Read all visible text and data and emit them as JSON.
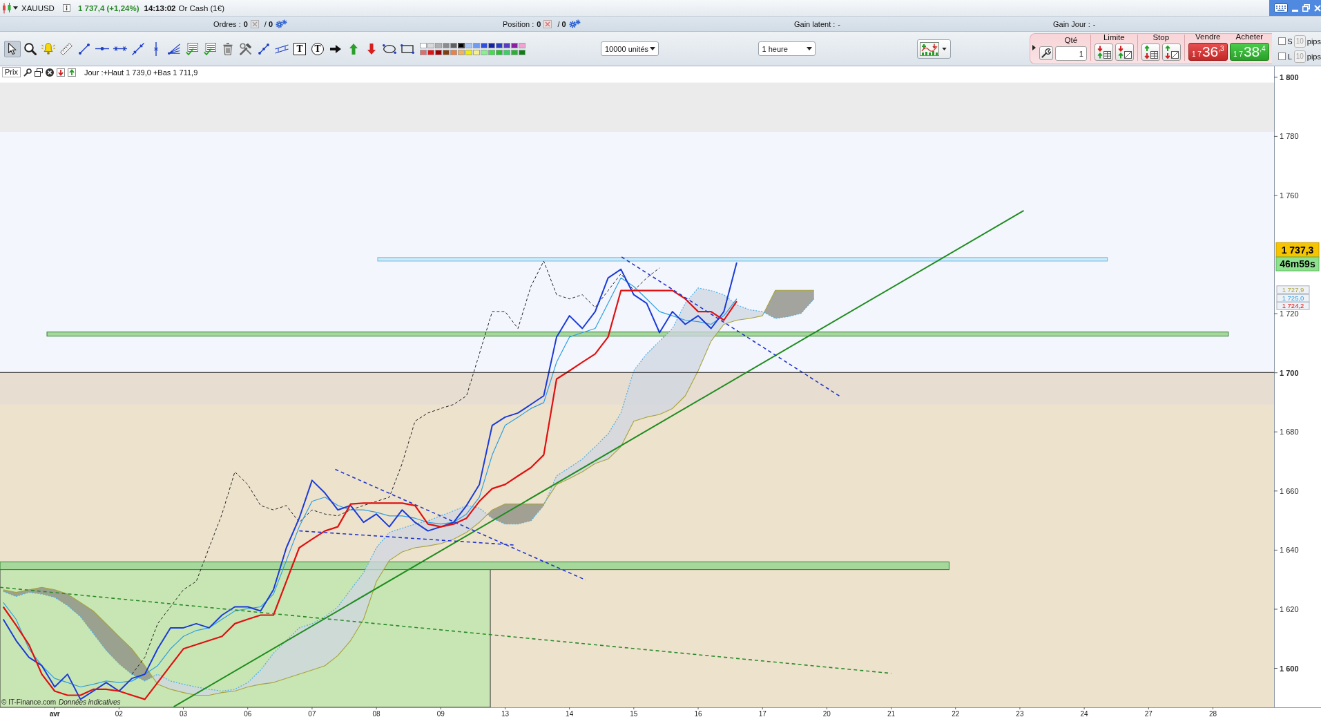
{
  "window": {
    "symbol": "XAUUSD",
    "quote": "1 737,4 (+1,24%)",
    "time": "14:13:02",
    "instrument": "Or Cash (1€)"
  },
  "account_bar": {
    "orders": {
      "label": "Ordres :",
      "count": "0",
      "pending": "/ **0**"
    },
    "position": {
      "label": "Position :",
      "count": "0",
      "pending": "/ **0**"
    },
    "unrealized_gain": {
      "label": "Gain latent :",
      "value": "-"
    },
    "daily_gain": {
      "label": "Gain Jour :",
      "value": "-"
    }
  },
  "toolbar": {
    "tools": [
      {
        "kind": "pointer",
        "selected": true
      },
      {
        "kind": "zoom",
        "selected": false
      },
      {
        "kind": "alert",
        "selected": false
      },
      {
        "kind": "ruler",
        "selected": false
      },
      {
        "kind": "segment",
        "selected": false
      },
      {
        "kind": "horizontal",
        "selected": false
      },
      {
        "kind": "hsegment",
        "selected": false
      },
      {
        "kind": "ray",
        "selected": false
      },
      {
        "kind": "vertical",
        "selected": false
      },
      {
        "kind": "fan",
        "selected": false
      },
      {
        "kind": "fibonacci",
        "selected": false
      },
      {
        "kind": "fibozone",
        "selected": false
      },
      {
        "kind": "delete",
        "selected": false
      },
      {
        "kind": "tools",
        "selected": false
      },
      {
        "kind": "cross",
        "selected": false
      },
      {
        "kind": "channel",
        "selected": false
      },
      {
        "kind": "text",
        "glyph": "T",
        "selected": false
      },
      {
        "kind": "bubble",
        "glyph": "T",
        "selected": false
      },
      {
        "kind": "arrowright",
        "selected": false
      },
      {
        "kind": "arrowup",
        "selected": false
      },
      {
        "kind": "arrowdown",
        "selected": false
      },
      {
        "kind": "ellipse",
        "selected": false
      },
      {
        "kind": "rectangle",
        "selected": false
      }
    ],
    "palette": [
      {
        "color": "#ffffff",
        "selected": false
      },
      {
        "color": "#d9d9d9",
        "selected": false
      },
      {
        "color": "#b0b0b0",
        "selected": false
      },
      {
        "color": "#8c8c8c",
        "selected": false
      },
      {
        "color": "#606060",
        "selected": false
      },
      {
        "color": "#000000",
        "selected": true
      },
      {
        "color": "#a9c6f5",
        "selected": false
      },
      {
        "color": "#6f9cf0",
        "selected": false
      },
      {
        "color": "#2f4fe0",
        "selected": false
      },
      {
        "color": "#14239e",
        "selected": false
      },
      {
        "color": "#2a3fc4",
        "selected": false
      },
      {
        "color": "#5a3cc0",
        "selected": false
      },
      {
        "color": "#8a1fa4",
        "selected": false
      },
      {
        "color": "#f2a3d2",
        "selected": false
      },
      {
        "color": "#e26c6c",
        "selected": false
      },
      {
        "color": "#e21212",
        "selected": false
      },
      {
        "color": "#a00000",
        "selected": false
      },
      {
        "color": "#7f3f10",
        "selected": false
      },
      {
        "color": "#f08040",
        "selected": false
      },
      {
        "color": "#f4b25c",
        "selected": false
      },
      {
        "color": "#f2ee00",
        "selected": false
      },
      {
        "color": "#f4f08a",
        "selected": false
      },
      {
        "color": "#88f08c",
        "selected": false
      },
      {
        "color": "#40e048",
        "selected": false
      },
      {
        "color": "#22c428",
        "selected": false
      },
      {
        "color": "#3dcf64",
        "selected": false
      },
      {
        "color": "#2fae34",
        "selected": false
      },
      {
        "color": "#127d14",
        "selected": false
      }
    ],
    "quantity_select": {
      "value": "10000 unités"
    },
    "period_select": {
      "value": "1 heure"
    }
  },
  "order_panel": {
    "quantity": {
      "label": "Qté",
      "value": "1"
    },
    "limit": {
      "label": "Limite"
    },
    "stop": {
      "label": "Stop"
    },
    "sell": {
      "label": "Vendre",
      "prefix": "1 7",
      "main": "36",
      "suffix": ",3"
    },
    "buy": {
      "label": "Acheter",
      "prefix": "1 7",
      "main": "38",
      "suffix": ",4"
    },
    "stops": [
      {
        "label": "S",
        "checked": false,
        "pips": "10",
        "disabled": true,
        "unit": "pips"
      },
      {
        "label": "L",
        "checked": false,
        "pips": "10",
        "disabled": true,
        "unit": "pips"
      }
    ]
  },
  "chart": {
    "header": {
      "label": "Prix",
      "info": "Jour :+Haut 1 739,0 +Bas 1 711,9"
    },
    "attribution": "© IT-Finance.com",
    "disclaimer": "Données indicatives",
    "chart_data": {
      "type": "line",
      "categories": [
        null,
        null,
        null,
        null,
        "avr",
        null,
        null,
        null,
        null,
        "02",
        null,
        null,
        null,
        null,
        "03",
        null,
        null,
        null,
        null,
        "06",
        null,
        null,
        null,
        null,
        "07",
        null,
        null,
        null,
        null,
        "08",
        null,
        null,
        null,
        null,
        "09",
        null,
        null,
        null,
        null,
        "13",
        null,
        null,
        null,
        null,
        "14",
        null,
        null,
        null,
        null,
        "15",
        null,
        null,
        null,
        null,
        "16",
        null,
        null,
        null,
        null,
        "17",
        null,
        null,
        null,
        null,
        "20",
        null,
        null,
        null,
        null,
        "21",
        null,
        null,
        null,
        null,
        "22",
        null,
        null,
        null,
        null,
        "23",
        null,
        null,
        null,
        null,
        "24",
        null,
        null,
        null,
        null,
        "27",
        null,
        null,
        null,
        null,
        "28",
        null,
        null,
        null,
        null
      ],
      "ylim": [
        1586.8,
        1803.7
      ],
      "yticks": [
        {
          "value": 1800,
          "label": "1 800"
        },
        {
          "value": 1780,
          "label": "1 780"
        },
        {
          "value": 1760,
          "label": "1 760"
        },
        {
          "value": 1720,
          "label": "1 720"
        },
        {
          "value": 1700,
          "label": "1 700"
        },
        {
          "value": 1680,
          "label": "1 680"
        },
        {
          "value": 1660,
          "label": "1 660"
        },
        {
          "value": 1640,
          "label": "1 640"
        },
        {
          "value": 1620,
          "label": "1 620"
        },
        {
          "value": 1600,
          "label": "1 600"
        }
      ],
      "series": [
        {
          "color": "#a7a33a",
          "line_style": "solid",
          "values": [
            1626.6,
            1625.7,
            1626.6,
            1627.4,
            1626.6,
            1625.1,
            1622.3,
            1619.4,
            1615.1,
            1610.8,
            1606.6,
            1600.9,
            1594.6,
            1592.9,
            1591.8,
            1590.9,
            1590.9,
            1591.8,
            1592.3,
            1593.7,
            1594.6,
            1595.2,
            1596.6,
            1598.0,
            1599.4,
            1600.9,
            1604.3,
            1609.4,
            1616.6,
            1629.4,
            1636.5,
            1639.4,
            1640.8,
            1641.4,
            1642.2,
            1643.7,
            1646.0,
            1649.4,
            1653.6,
            1655.6,
            1655.6,
            1655.6,
            1655.6,
            1662.2,
            1664.2,
            1666.5,
            1669.3,
            1670.8,
            1675.0,
            1683.6,
            1685.0,
            1685.9,
            1687.9,
            1692.2,
            1700.7,
            1710.7,
            1716.4,
            1717.8,
            1718.4,
            1719.3,
            1727.9,
            1727.9,
            1727.9,
            1727.9,
            null,
            null,
            null,
            null,
            null,
            null,
            null,
            null,
            null,
            null,
            null,
            null,
            null,
            null,
            null,
            null,
            null,
            null,
            null,
            null,
            null,
            null,
            null,
            null,
            null,
            null,
            null,
            null,
            null,
            null,
            null,
            null,
            null,
            null,
            null
          ]
        },
        {
          "color": "#4fb0e8",
          "line_style": "dotted",
          "values": [
            1626.0,
            1624.3,
            1625.7,
            1625.1,
            1624.0,
            1621.2,
            1617.5,
            1611.8,
            1606.1,
            1601.5,
            1598.0,
            1595.7,
            1598.0,
            1595.7,
            1594.6,
            1593.7,
            1592.9,
            1592.3,
            1592.9,
            1595.2,
            1599.4,
            1605.1,
            1609.4,
            1613.7,
            1615.1,
            1617.5,
            1620.8,
            1626.6,
            1632.3,
            1640.8,
            1646.0,
            1647.4,
            1648.8,
            1649.9,
            1651.6,
            1653.3,
            1655.1,
            1654.2,
            1650.8,
            1648.8,
            1648.8,
            1649.9,
            1655.1,
            1665.1,
            1667.9,
            1670.8,
            1675.0,
            1679.3,
            1686.4,
            1700.7,
            1706.4,
            1710.7,
            1715.0,
            1723.5,
            1728.7,
            1727.8,
            1726.4,
            1723.0,
            1721.3,
            1720.7,
            1718.4,
            1719.0,
            1720.1,
            1725.0,
            null,
            null,
            null,
            null,
            null,
            null,
            null,
            null,
            null,
            null,
            null,
            null,
            null,
            null,
            null,
            null,
            null,
            null,
            null,
            null,
            null,
            null,
            null,
            null,
            null,
            null,
            null,
            null,
            null,
            null,
            null,
            null,
            null,
            null,
            null
          ]
        },
        {
          "color": "#222222",
          "line_style": "dashed",
          "values": [
            null,
            null,
            null,
            null,
            null,
            null,
            null,
            null,
            null,
            null,
            1598.0,
            1603.7,
            1615.1,
            1620.8,
            1626.6,
            1629.4,
            1640.8,
            1652.2,
            1666.5,
            1662.2,
            1655.1,
            1653.6,
            1655.1,
            1649.4,
            1653.6,
            1652.2,
            1651.6,
            1653.6,
            1655.1,
            1656.5,
            1657.9,
            1669.3,
            1683.6,
            1686.4,
            1687.9,
            1689.3,
            1692.2,
            1706.4,
            1720.7,
            1720.7,
            1715.0,
            1729.2,
            1737.8,
            1726.4,
            1725.0,
            1726.4,
            1722.1,
            1727.8,
            1733.5,
            1727.8,
            1732.1,
            1735.5,
            null,
            null,
            null,
            null,
            null,
            null,
            null,
            null,
            null,
            null,
            null,
            null,
            null,
            null,
            null,
            null,
            null,
            null,
            null,
            null,
            null,
            null,
            null,
            null,
            null,
            null,
            null,
            null,
            null,
            null,
            null,
            null,
            null,
            null,
            null,
            null,
            null,
            null,
            null,
            null,
            null,
            null,
            null,
            null,
            null,
            null,
            null
          ]
        },
        {
          "color": "#2e9fe0",
          "line_style": "solid",
          "values": [
            1622.3,
            1616.6,
            1606.6,
            1600.9,
            1596.6,
            1595.2,
            1593.7,
            1594.6,
            1595.7,
            1595.2,
            1595.7,
            1598.0,
            1600.9,
            1606.6,
            1610.8,
            1612.8,
            1613.7,
            1616.6,
            1619.4,
            1620.2,
            1620.8,
            1625.1,
            1636.5,
            1647.9,
            1656.5,
            1657.9,
            1655.1,
            1653.6,
            1653.6,
            1652.8,
            1651.6,
            1651.6,
            1650.8,
            1649.4,
            1648.8,
            1649.4,
            1652.2,
            1657.9,
            1672.2,
            1682.2,
            1685.0,
            1687.9,
            1689.9,
            1703.6,
            1712.1,
            1713.6,
            1715.0,
            1723.5,
            1732.1,
            1729.2,
            1725.0,
            1720.7,
            1719.3,
            1717.8,
            1717.3,
            1716.4,
            1719.3,
            1725.0,
            null,
            null,
            null,
            null,
            null,
            null,
            null,
            null,
            null,
            null,
            null,
            null,
            null,
            null,
            null,
            null,
            null,
            null,
            null,
            null,
            null,
            null,
            null,
            null,
            null,
            null,
            null,
            null,
            null,
            null,
            null,
            null,
            null,
            null,
            null,
            null,
            null,
            null,
            null,
            null,
            null
          ]
        },
        {
          "color": "#1a3ad8",
          "line_style": "solid",
          "values": [
            1616.6,
            1609.4,
            1603.7,
            1600.9,
            1593.7,
            1598.0,
            1589.5,
            1592.3,
            1595.2,
            1592.3,
            1596.6,
            1598.0,
            1606.6,
            1613.7,
            1613.7,
            1615.1,
            1613.7,
            1618.0,
            1620.8,
            1620.8,
            1619.4,
            1626.6,
            1640.8,
            1650.8,
            1663.6,
            1659.3,
            1653.6,
            1655.1,
            1649.4,
            1652.2,
            1647.9,
            1653.6,
            1649.4,
            1646.5,
            1647.9,
            1649.4,
            1655.1,
            1662.2,
            1682.2,
            1685.0,
            1686.4,
            1689.3,
            1692.2,
            1712.1,
            1719.3,
            1715.0,
            1720.7,
            1732.1,
            1735.0,
            1726.4,
            1723.5,
            1713.6,
            1720.7,
            1716.4,
            1719.3,
            1715.0,
            1720.7,
            1737.3,
            null,
            null,
            null,
            null,
            null,
            null,
            null,
            null,
            null,
            null,
            null,
            null,
            null,
            null,
            null,
            null,
            null,
            null,
            null,
            null,
            null,
            null,
            null,
            null,
            null,
            null,
            null,
            null,
            null,
            null,
            null,
            null,
            null,
            null,
            null,
            null,
            null,
            null,
            null,
            null,
            null
          ]
        },
        {
          "color": "#e01010",
          "line_style": "solid",
          "values": [
            1620.8,
            1614.6,
            1608.0,
            1598.0,
            1592.3,
            1590.9,
            1590.9,
            1592.9,
            1592.9,
            1592.3,
            1590.9,
            1589.5,
            1595.2,
            1600.9,
            1606.6,
            1608.0,
            1609.4,
            1610.8,
            1615.1,
            1616.6,
            1618.0,
            1618.0,
            1629.4,
            1640.8,
            1643.7,
            1646.5,
            1647.9,
            1655.6,
            1655.9,
            1655.9,
            1655.9,
            1655.9,
            1655.1,
            1648.8,
            1647.9,
            1648.8,
            1650.8,
            1656.5,
            1660.8,
            1662.2,
            1665.1,
            1667.9,
            1672.2,
            1697.9,
            1700.7,
            1703.6,
            1706.4,
            1712.1,
            1727.8,
            1727.8,
            1727.8,
            1727.8,
            1727.8,
            1725.0,
            1720.7,
            1720.7,
            1717.8,
            1724.2,
            null,
            null,
            null,
            null,
            null,
            null,
            null,
            null,
            null,
            null,
            null,
            null,
            null,
            null,
            null,
            null,
            null,
            null,
            null,
            null,
            null,
            null,
            null,
            null,
            null,
            null,
            null,
            null,
            null,
            null,
            null,
            null,
            null,
            null,
            null,
            null,
            null,
            null,
            null,
            null,
            null
          ]
        }
      ],
      "annotations": [
        "1 737,3",
        "46m59s",
        "1 727,9",
        "1 725,0",
        "1 724,2"
      ]
    }
  }
}
